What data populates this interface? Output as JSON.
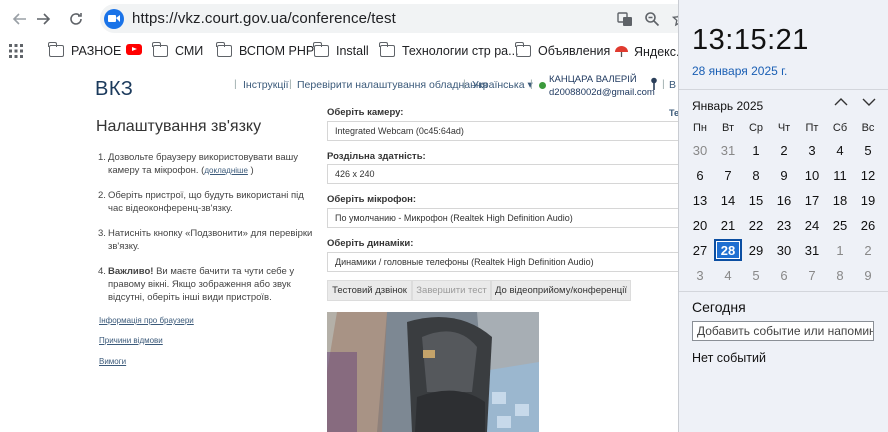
{
  "browser": {
    "url": "https://vkz.court.gov.ua/conference/test",
    "bookmarks": [
      "РАЗНОЕ",
      "СМИ",
      "ВСПОМ PHP",
      "Install",
      "Технологии стр ра...",
      "Объявления",
      "Яндекс.П"
    ]
  },
  "site": {
    "logo": "ВКЗ",
    "nav": [
      "Інструкції",
      "Перевірити налаштування обладнання",
      "Українська ▾"
    ],
    "user_name": "КАНЦАРА ВАЛЕРІЙ",
    "user_email": "d20088002d@gmail.com",
    "nav_cut": "В",
    "right_cut": "Те"
  },
  "settings": {
    "title": "Налаштування зв'язку",
    "steps": [
      {
        "num": "1.",
        "text": "Дозвольте браузеру використовувати вашу камеру та мікрофон. (",
        "more": "докладніше",
        "after": " )"
      },
      {
        "num": "2.",
        "text": "Оберіть пристрої, що будуть використані під час відеоконференц-зв'язку."
      },
      {
        "num": "3.",
        "text": "Натисніть кнопку «Подзвонити» для перевірки зв'язку."
      },
      {
        "num": "4.",
        "bold": "Важливо!",
        "text": " Ви маєте бачити та чути себе у правому вікні. Якщо зображення або звук відсутні, оберіть інші види пристроїв."
      }
    ],
    "links": [
      "Інформація про браузери",
      "Причини відмови",
      "Вимоги"
    ],
    "camera_label": "Оберіть камеру:",
    "camera_value": "Integrated Webcam (0c45:64ad)",
    "resolution_label": "Роздільна здатність:",
    "resolution_value": "426 x 240",
    "mic_label": "Оберіть мікрофон:",
    "mic_value": "По умолчанию - Микрофон (Realtek High Definition Audio)",
    "speaker_label": "Оберіть динаміки:",
    "speaker_value": "Динамики / головные телефоны (Realtek High Definition Audio)",
    "btn_test": "Тестовий дзвінок",
    "btn_end": "Завершити тест",
    "btn_join": "До відеоприйому/конференції"
  },
  "calendar": {
    "time": "13:15:21",
    "date": "28 января 2025 г.",
    "month": "Январь 2025",
    "weekdays": [
      "Пн",
      "Вт",
      "Ср",
      "Чт",
      "Пт",
      "Сб",
      "Вс"
    ],
    "weeks": [
      [
        "30",
        "31",
        "1",
        "2",
        "3",
        "4",
        "5"
      ],
      [
        "6",
        "7",
        "8",
        "9",
        "10",
        "11",
        "12"
      ],
      [
        "13",
        "14",
        "15",
        "16",
        "17",
        "18",
        "19"
      ],
      [
        "20",
        "21",
        "22",
        "23",
        "24",
        "25",
        "26"
      ],
      [
        "27",
        "28",
        "29",
        "30",
        "31",
        "1",
        "2"
      ],
      [
        "3",
        "4",
        "5",
        "6",
        "7",
        "8",
        "9"
      ]
    ],
    "today_label": "Сегодня",
    "event_placeholder": "Добавить событие или напоминание",
    "no_events": "Нет событий"
  }
}
